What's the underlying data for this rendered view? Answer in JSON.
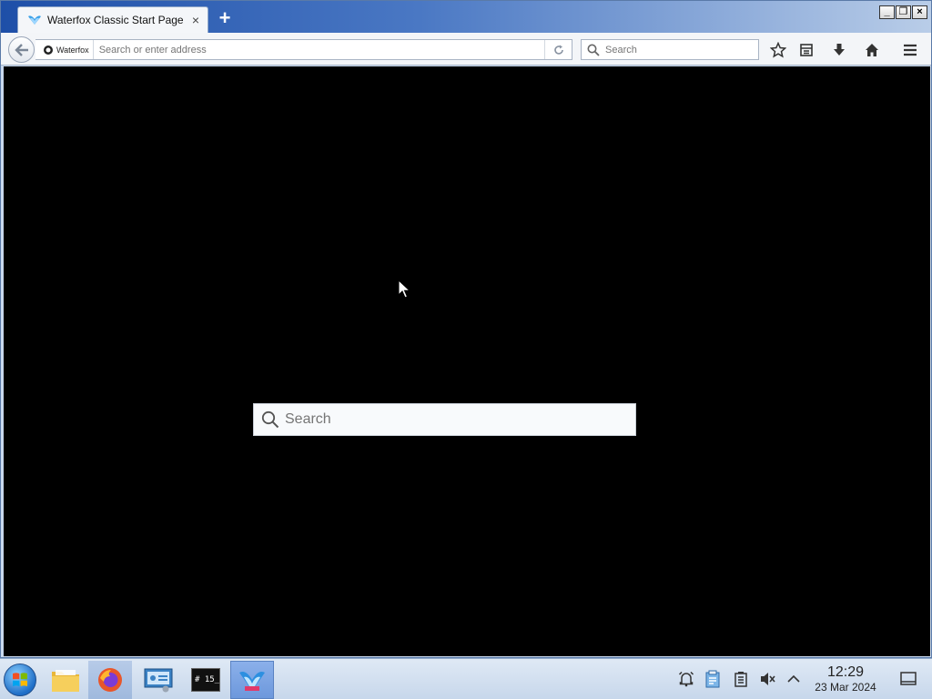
{
  "browser": {
    "tab_title": "Waterfox Classic Start Page",
    "new_tab_symbol": "+",
    "close_symbol": "×",
    "identity_label": "Waterfox",
    "url_placeholder": "Search or enter address",
    "search_placeholder": "Search",
    "window_controls": [
      "_",
      "❐",
      "×"
    ]
  },
  "content": {
    "page_search_placeholder": "Search",
    "background_color": "#000000"
  },
  "taskbar": {
    "apps": [
      "windows-start-icon",
      "file-manager-icon",
      "firefox-icon",
      "system-settings-icon",
      "terminal-icon",
      "waterfox-icon"
    ],
    "terminal_label": "# 15_",
    "clock": {
      "time": "12:29",
      "date": "23 Mar 2024"
    },
    "tray_icons": [
      "alarm-icon",
      "clipboard-icon",
      "battery-icon",
      "volume-muted-icon",
      "chevron-up-icon",
      "notifications-icon"
    ]
  }
}
